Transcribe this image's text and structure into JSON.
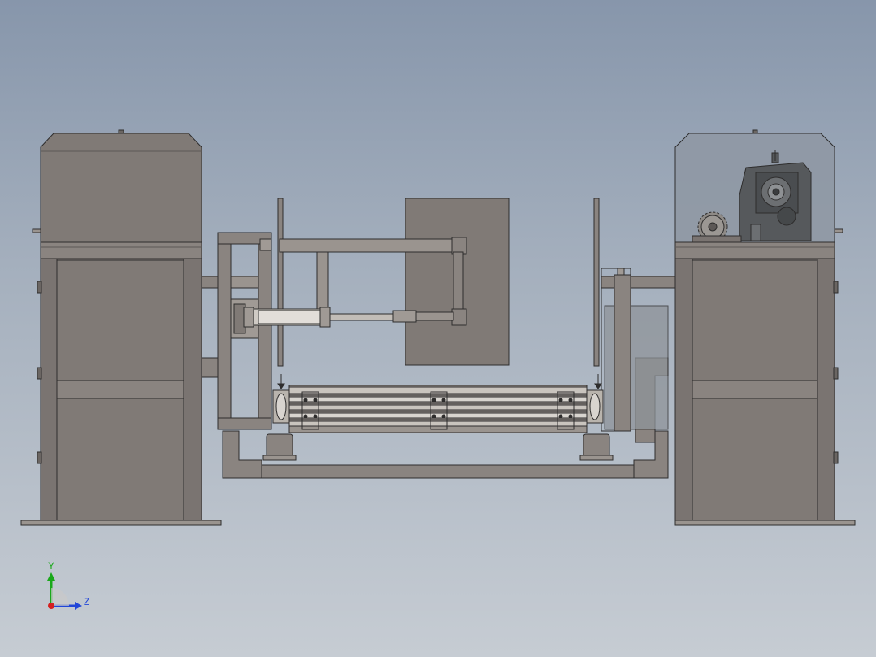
{
  "viewport": {
    "background_top": "#8796ab",
    "background_bottom": "#c6ccd3"
  },
  "colors": {
    "body": "#807a76",
    "panel_dark": "#7a7471",
    "outline": "#2e2d2d",
    "glass": "#8f98a4",
    "steel": "#b9b4ad",
    "gearbox": "#56595c"
  },
  "triad": {
    "y_label": "Y",
    "z_label": "Z",
    "y_color": "#1aa81a",
    "z_color": "#2146d8",
    "x_color": "#d42020"
  }
}
